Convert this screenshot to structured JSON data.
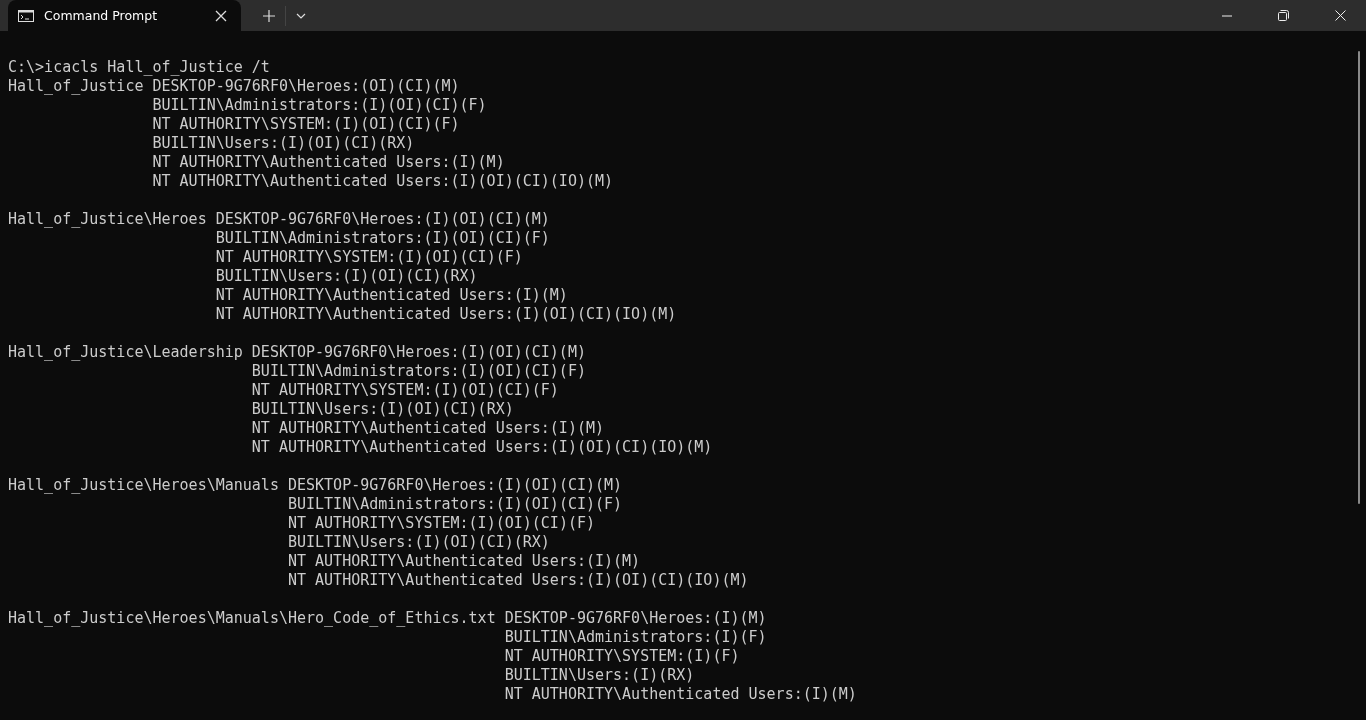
{
  "tab": {
    "title": "Command Prompt",
    "selected": true
  },
  "command_line": "C:\\>icacls Hall_of_Justice /t",
  "output": [
    {
      "path": "Hall_of_Justice",
      "entries": [
        "DESKTOP-9G76RF0\\Heroes:(OI)(CI)(M)",
        "BUILTIN\\Administrators:(I)(OI)(CI)(F)",
        "NT AUTHORITY\\SYSTEM:(I)(OI)(CI)(F)",
        "BUILTIN\\Users:(I)(OI)(CI)(RX)",
        "NT AUTHORITY\\Authenticated Users:(I)(M)",
        "NT AUTHORITY\\Authenticated Users:(I)(OI)(CI)(IO)(M)"
      ]
    },
    {
      "path": "Hall_of_Justice\\Heroes",
      "entries": [
        "DESKTOP-9G76RF0\\Heroes:(I)(OI)(CI)(M)",
        "BUILTIN\\Administrators:(I)(OI)(CI)(F)",
        "NT AUTHORITY\\SYSTEM:(I)(OI)(CI)(F)",
        "BUILTIN\\Users:(I)(OI)(CI)(RX)",
        "NT AUTHORITY\\Authenticated Users:(I)(M)",
        "NT AUTHORITY\\Authenticated Users:(I)(OI)(CI)(IO)(M)"
      ]
    },
    {
      "path": "Hall_of_Justice\\Leadership",
      "entries": [
        "DESKTOP-9G76RF0\\Heroes:(I)(OI)(CI)(M)",
        "BUILTIN\\Administrators:(I)(OI)(CI)(F)",
        "NT AUTHORITY\\SYSTEM:(I)(OI)(CI)(F)",
        "BUILTIN\\Users:(I)(OI)(CI)(RX)",
        "NT AUTHORITY\\Authenticated Users:(I)(M)",
        "NT AUTHORITY\\Authenticated Users:(I)(OI)(CI)(IO)(M)"
      ]
    },
    {
      "path": "Hall_of_Justice\\Heroes\\Manuals",
      "entries": [
        "DESKTOP-9G76RF0\\Heroes:(I)(OI)(CI)(M)",
        "BUILTIN\\Administrators:(I)(OI)(CI)(F)",
        "NT AUTHORITY\\SYSTEM:(I)(OI)(CI)(F)",
        "BUILTIN\\Users:(I)(OI)(CI)(RX)",
        "NT AUTHORITY\\Authenticated Users:(I)(M)",
        "NT AUTHORITY\\Authenticated Users:(I)(OI)(CI)(IO)(M)"
      ]
    },
    {
      "path": "Hall_of_Justice\\Heroes\\Manuals\\Hero_Code_of_Ethics.txt",
      "entries": [
        "DESKTOP-9G76RF0\\Heroes:(I)(M)",
        "BUILTIN\\Administrators:(I)(F)",
        "NT AUTHORITY\\SYSTEM:(I)(F)",
        "BUILTIN\\Users:(I)(RX)",
        "NT AUTHORITY\\Authenticated Users:(I)(M)"
      ]
    }
  ]
}
